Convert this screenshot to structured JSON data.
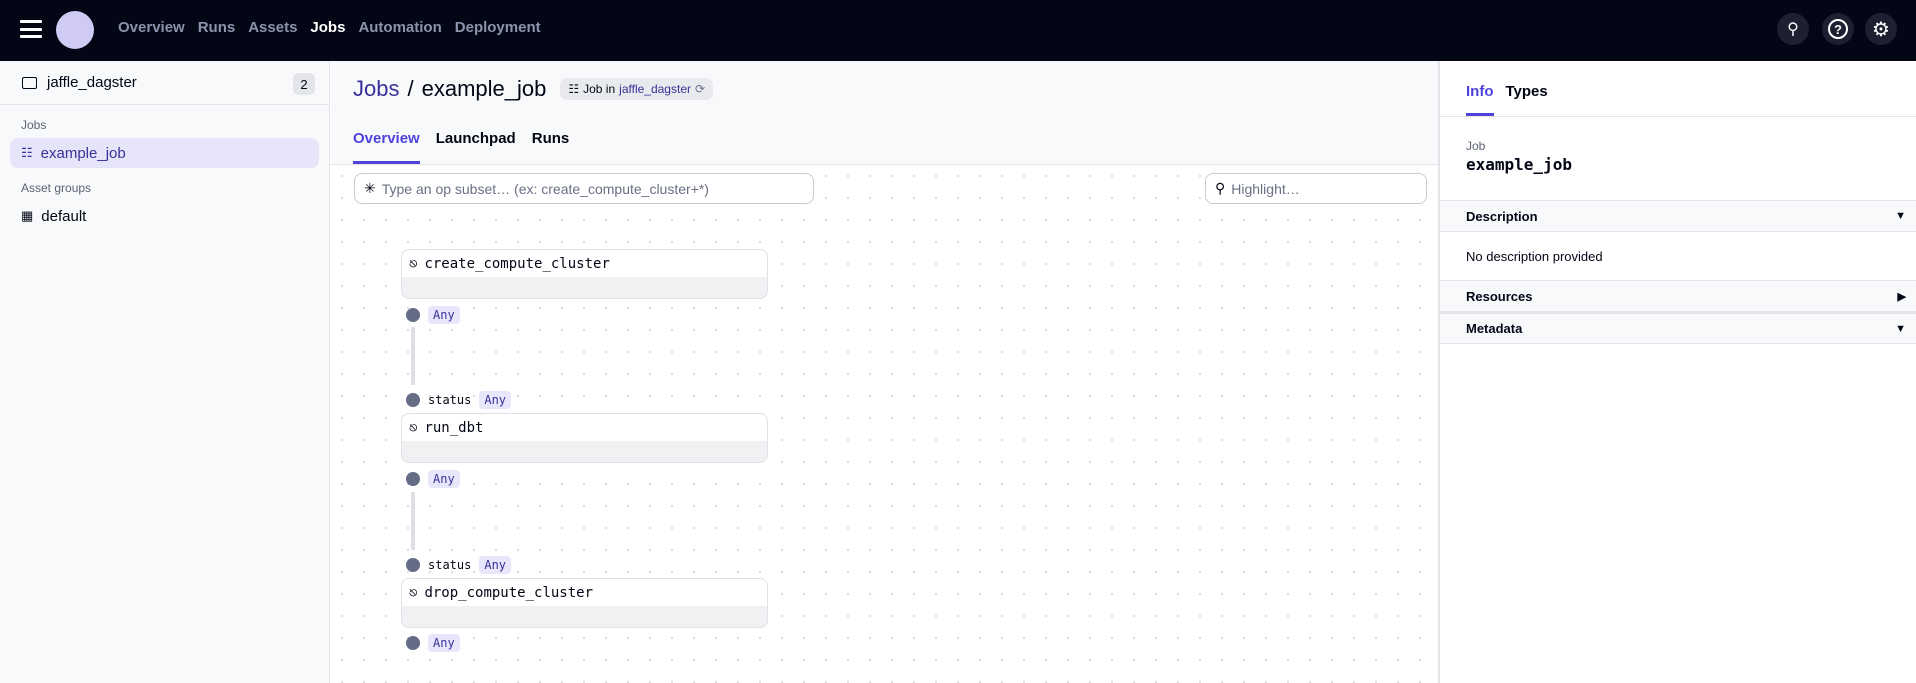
{
  "topnav": {
    "items": [
      "Overview",
      "Runs",
      "Assets",
      "Jobs",
      "Automation",
      "Deployment"
    ],
    "active": "Jobs",
    "icons": [
      "search-icon",
      "help-icon",
      "gear-icon"
    ]
  },
  "sidebar": {
    "repo": "jaffle_dagster",
    "repo_count": "2",
    "jobs_header": "Jobs",
    "jobs": [
      "example_job"
    ],
    "asset_groups_header": "Asset groups",
    "asset_groups": [
      "default"
    ]
  },
  "header": {
    "breadcrumb_root": "Jobs",
    "separator": "/",
    "job_name": "example_job",
    "tag_prefix": "Job in",
    "tag_repo": "jaffle_dagster",
    "tabs": [
      "Overview",
      "Launchpad",
      "Runs"
    ],
    "active_tab": "Overview"
  },
  "graph": {
    "subset_placeholder": "Type an op subset… (ex: create_compute_cluster+*)",
    "highlight_placeholder": "Highlight…",
    "ops": [
      {
        "name": "create_compute_cluster",
        "input": null,
        "output_type": "Any"
      },
      {
        "name": "run_dbt",
        "input": "status",
        "input_type": "Any",
        "output_type": "Any"
      },
      {
        "name": "drop_compute_cluster",
        "input": "status",
        "input_type": "Any",
        "output_type": "Any"
      }
    ]
  },
  "panel": {
    "tabs": [
      "Info",
      "Types"
    ],
    "active_tab": "Info",
    "job_label": "Job",
    "job_name": "example_job",
    "sections": [
      {
        "title": "Description",
        "body": "No description provided",
        "state": "expanded"
      },
      {
        "title": "Resources",
        "state": "collapsed"
      },
      {
        "title": "Metadata",
        "state": "expanded"
      }
    ]
  },
  "colors": {
    "accent": "#4f43dd",
    "topbar": "#030615",
    "link": "#3b3098"
  }
}
